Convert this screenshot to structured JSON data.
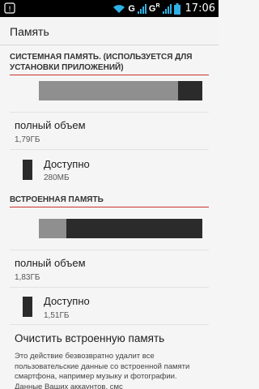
{
  "status_bar": {
    "time": "17:06",
    "network_1": "G",
    "network_2": "G",
    "network_2_sub": "R",
    "accent": "#2fb1e6"
  },
  "action_bar": {
    "title": "Память"
  },
  "system_memory": {
    "header": "СИСТЕМНАЯ ПАМЯТЬ. (ИСПОЛЬЗУЕТСЯ ДЛЯ УСТАНОВКИ ПРИЛОЖЕНИЙ)",
    "bar": {
      "used_fraction": 0.85,
      "used_color": "#8f8f8f",
      "free_color": "#2b2b2b"
    },
    "total_label": "полный объем",
    "total_value": "1,79ГБ",
    "available_label": "Доступно",
    "available_value": "280МБ"
  },
  "internal_memory": {
    "header": "ВСТРОЕННАЯ ПАМЯТЬ",
    "bar": {
      "used_fraction": 0.17,
      "used_color": "#8f8f8f",
      "free_color": "#2b2b2b"
    },
    "total_label": "полный объем",
    "total_value": "1,83ГБ",
    "available_label": "Доступно",
    "available_value": "1,51ГБ"
  },
  "clear_internal": {
    "title": "Очистить встроенную память",
    "description": "Это действие безвозвратно удалит все пользовательские данные со встроенной памяти смартфона, например музыку и фотографии. Данные Ваших аккаунтов, смс"
  }
}
